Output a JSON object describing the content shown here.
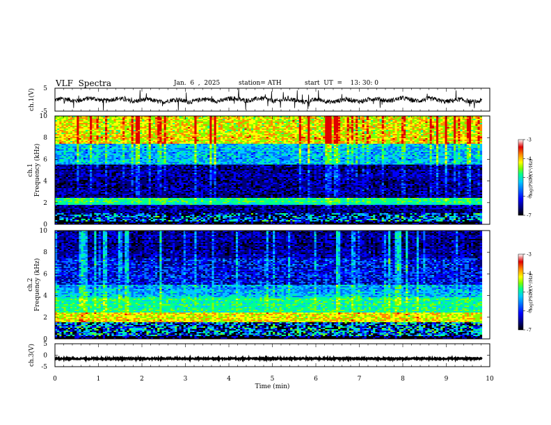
{
  "header": {
    "title": "VLF  Spectra",
    "date": "Jan.  6  ,  2025",
    "station": "station= ATH",
    "start": "start  UT  =    13: 30: 0"
  },
  "colors": {
    "spectrogram": [
      "#000000",
      "#00007a",
      "#0000ff",
      "#0070ff",
      "#00c8ff",
      "#00ff90",
      "#80ff00",
      "#ffff00",
      "#ff8c00",
      "#e00000",
      "#ffffff"
    ],
    "trace": "#000000"
  },
  "chart_data": [
    {
      "type": "line",
      "panel": "ch1-waveform",
      "ylabel": "ch.1(V)",
      "ylim": [
        -5,
        5
      ],
      "yticks": [
        "5",
        "-5"
      ],
      "xlim": [
        0,
        10
      ],
      "series": [
        {
          "x_range": [
            0,
            9.82
          ],
          "baseline": -0.2,
          "noise_amplitude": 1.0
        }
      ]
    },
    {
      "type": "heatmap",
      "panel": "ch1-spectrogram",
      "ylabel": "ch.1\nFrequency  (kHz)",
      "ylim": [
        0,
        10
      ],
      "yticks": [
        "0",
        "2",
        "4",
        "6",
        "8",
        "10"
      ],
      "xlim": [
        0,
        10
      ],
      "x_range": [
        0,
        9.82
      ],
      "bands": [
        {
          "f": [
            0.0,
            0.3
          ],
          "level": "black"
        },
        {
          "f": [
            0.3,
            1.0
          ],
          "level": "mixed-dark"
        },
        {
          "f": [
            1.0,
            1.8
          ],
          "level": "dark-blue"
        },
        {
          "f": [
            1.8,
            2.5
          ],
          "level": "green"
        },
        {
          "f": [
            2.5,
            5.5
          ],
          "level": "dark-blue"
        },
        {
          "f": [
            5.5,
            7.5
          ],
          "level": "cyan"
        },
        {
          "f": [
            7.5,
            10.0
          ],
          "level": "yellow-red"
        }
      ],
      "colorbar": {
        "label": "log(PSD)(V²/Hz)",
        "range": [
          -7,
          -3
        ],
        "ticks": [
          "-3",
          "-4",
          "-5",
          "-6",
          "-7"
        ]
      }
    },
    {
      "type": "heatmap",
      "panel": "ch2-spectrogram",
      "ylabel": "ch.2\nFrequency  (kHz)",
      "ylim": [
        0,
        10
      ],
      "yticks": [
        "0",
        "2",
        "4",
        "6",
        "8",
        "10"
      ],
      "xlim": [
        0,
        10
      ],
      "x_range": [
        0,
        9.82
      ],
      "bands": [
        {
          "f": [
            0.0,
            0.3
          ],
          "level": "black"
        },
        {
          "f": [
            0.3,
            1.5
          ],
          "level": "mixed-dark"
        },
        {
          "f": [
            1.5,
            2.5
          ],
          "level": "red-yellow"
        },
        {
          "f": [
            2.5,
            3.8
          ],
          "level": "green"
        },
        {
          "f": [
            3.8,
            5.0
          ],
          "level": "cyan"
        },
        {
          "f": [
            5.0,
            7.5
          ],
          "level": "blue"
        },
        {
          "f": [
            7.5,
            10.0
          ],
          "level": "dark-blue"
        }
      ],
      "colorbar": {
        "label": "log(PSD)(V²/Hz)",
        "range": [
          -7,
          -3
        ],
        "ticks": [
          "-3",
          "-4",
          "-5",
          "-6",
          "-7"
        ]
      }
    },
    {
      "type": "line",
      "panel": "ch3-waveform",
      "ylabel": "ch.3(V)",
      "ylim": [
        -5,
        5
      ],
      "yticks": [
        "5",
        "0",
        "-5"
      ],
      "xlim": [
        0,
        10
      ],
      "xlabel": "Time  (min)",
      "xticks": [
        "0",
        "1",
        "2",
        "3",
        "4",
        "5",
        "6",
        "7",
        "8",
        "9",
        "10"
      ],
      "series": [
        {
          "x_range": [
            0,
            9.82
          ],
          "baseline": -1.5,
          "noise_amplitude": 0.3
        }
      ]
    }
  ]
}
